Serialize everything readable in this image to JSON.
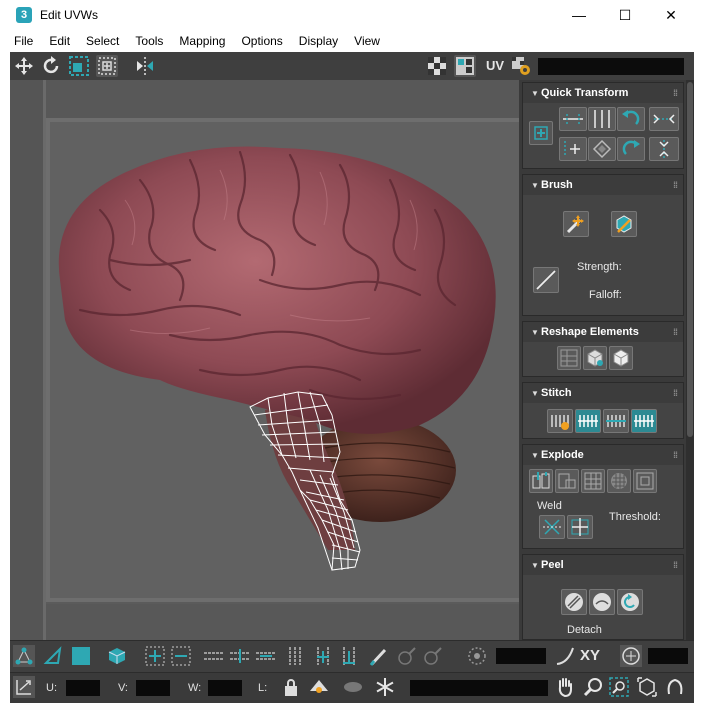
{
  "window": {
    "title": "Edit UVWs",
    "app_icon_label": "3",
    "controls": {
      "minimize": "—",
      "maximize": "☐",
      "close": "✕"
    }
  },
  "menu": [
    "File",
    "Edit",
    "Select",
    "Tools",
    "Mapping",
    "Options",
    "Display",
    "View"
  ],
  "top_toolbar": {
    "uv_label": "UV",
    "accent_color": "#2ea8b3"
  },
  "panel": {
    "quick_transform": {
      "title": "Quick Transform"
    },
    "brush": {
      "title": "Brush",
      "strength_label": "Strength:",
      "falloff_label": "Falloff:"
    },
    "reshape": {
      "title": "Reshape Elements"
    },
    "stitch": {
      "title": "Stitch"
    },
    "explode": {
      "title": "Explode",
      "weld_label": "Weld",
      "threshold_label": "Threshold:"
    },
    "peel": {
      "title": "Peel",
      "detach_label": "Detach"
    }
  },
  "bottom_toolbar": {
    "xy_label": "XY",
    "u_label": "U:",
    "v_label": "V:",
    "w_label": "W:",
    "l_label": "L:"
  },
  "colors": {
    "toolbar_bg": "#3f3f3f",
    "panel_bg": "#444444",
    "viewport_bg": "#5b5b5b",
    "teal": "#2ea8b3",
    "uv_wire": "#ffffff"
  }
}
